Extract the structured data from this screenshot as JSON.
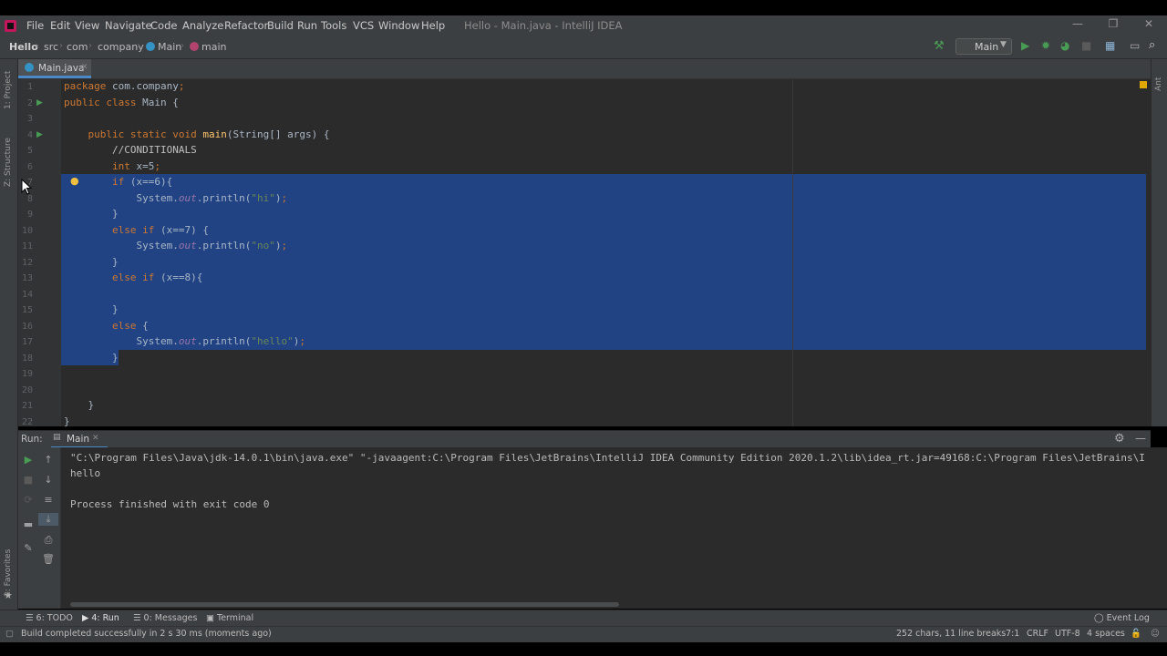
{
  "window": {
    "title": "Hello - Main.java - IntelliJ IDEA",
    "menu": [
      "File",
      "Edit",
      "View",
      "Navigate",
      "Code",
      "Analyze",
      "Refactor",
      "Build",
      "Run",
      "Tools",
      "VCS",
      "Window",
      "Help"
    ],
    "controls": {
      "minimize": "—",
      "maximize": "❐",
      "close": "✕"
    }
  },
  "breadcrumbs": [
    "Hello",
    "src",
    "com",
    "company",
    "Main",
    "main"
  ],
  "run_config": {
    "label": "Main"
  },
  "tool_windows": {
    "project": "1: Project",
    "structure": "Z: Structure",
    "favorites": "2: Favorites",
    "ant": "Ant"
  },
  "editor": {
    "tab": "Main.java",
    "lines": [
      {
        "n": "1",
        "text": "package com.company;"
      },
      {
        "n": "2",
        "text": "public class Main {"
      },
      {
        "n": "3",
        "text": ""
      },
      {
        "n": "4",
        "text": "    public static void main(String[] args) {"
      },
      {
        "n": "5",
        "text": "        //CONDITIONALS"
      },
      {
        "n": "6",
        "text": "        int x=5;"
      },
      {
        "n": "7",
        "text": "        if (x==6){"
      },
      {
        "n": "8",
        "text": "            System.out.println(\"hi\");"
      },
      {
        "n": "9",
        "text": "        }"
      },
      {
        "n": "10",
        "text": "        else if (x==7) {"
      },
      {
        "n": "11",
        "text": "            System.out.println(\"no\");"
      },
      {
        "n": "12",
        "text": "        }"
      },
      {
        "n": "13",
        "text": "        else if (x==8){"
      },
      {
        "n": "14",
        "text": ""
      },
      {
        "n": "15",
        "text": "        }"
      },
      {
        "n": "16",
        "text": "        else {"
      },
      {
        "n": "17",
        "text": "            System.out.println(\"hello\");"
      },
      {
        "n": "18",
        "text": "        }"
      },
      {
        "n": "19",
        "text": ""
      },
      {
        "n": "20",
        "text": ""
      },
      {
        "n": "21",
        "text": "    }"
      },
      {
        "n": "22",
        "text": "}"
      }
    ],
    "selection": {
      "from_line": 7,
      "to_line": 18
    }
  },
  "run_panel": {
    "label": "Run:",
    "tab": "Main",
    "output": [
      "\"C:\\Program Files\\Java\\jdk-14.0.1\\bin\\java.exe\" \"-javaagent:C:\\Program Files\\JetBrains\\IntelliJ IDEA Community Edition 2020.1.2\\lib\\idea_rt.jar=49168:C:\\Program Files\\JetBrains\\I",
      "hello",
      "",
      "Process finished with exit code 0"
    ]
  },
  "bottom_tabs": [
    "6: TODO",
    "4: Run",
    "0: Messages",
    "Terminal"
  ],
  "event_log": "Event Log",
  "status": {
    "message": "Build completed successfully in 2 s 30 ms (moments ago)",
    "chars": "252 chars, 11 line breaks",
    "position": "7:1",
    "line_sep": "CRLF",
    "encoding": "UTF-8",
    "indent": "4 spaces"
  },
  "colors": {
    "selection": "#214283",
    "keyword": "#cc7832",
    "method": "#ffc66d",
    "string": "#6a8759",
    "background": "#2b2b2b"
  }
}
